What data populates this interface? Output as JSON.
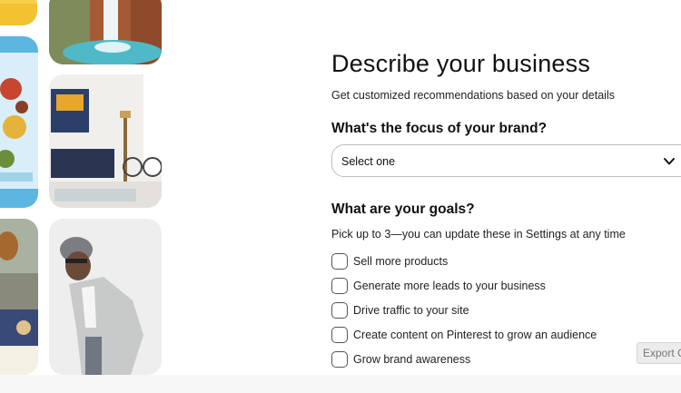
{
  "form": {
    "title": "Describe your business",
    "subtitle": "Get customized recommendations based on your details",
    "focus_question": "What's the focus of your brand?",
    "focus_select": {
      "selected": "Select one",
      "icon": "chevron-down-icon"
    },
    "goals_question": "What are your goals?",
    "goals_hint": "Pick up to 3—you can update these in Settings at any time",
    "goals": [
      {
        "label": "Sell more products",
        "checked": false
      },
      {
        "label": "Generate more leads to your business",
        "checked": false
      },
      {
        "label": "Drive traffic to your site",
        "checked": false
      },
      {
        "label": "Create content on Pinterest to grow an audience",
        "checked": false
      },
      {
        "label": "Grow brand awareness",
        "checked": false
      }
    ]
  },
  "export_button": "Export C",
  "images": [
    "yellow-partial-image",
    "waterfall-image",
    "food-platter-image",
    "living-room-image",
    "bedroom-decor-image",
    "man-in-blazer-image"
  ]
}
